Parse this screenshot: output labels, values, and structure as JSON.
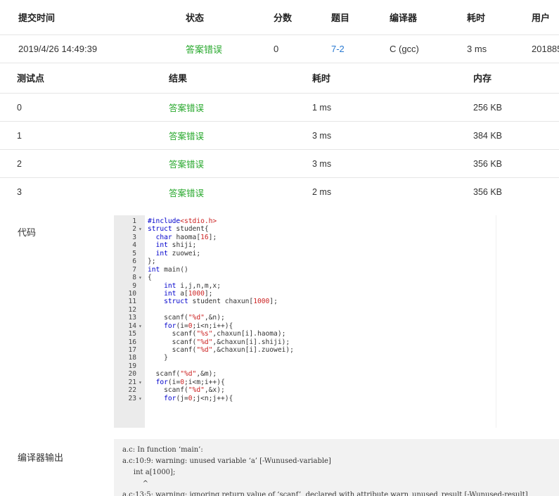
{
  "submission": {
    "headers": {
      "time": "提交时间",
      "status": "状态",
      "score": "分数",
      "problem": "题目",
      "compiler": "编译器",
      "duration": "耗时",
      "user": "用户"
    },
    "row": {
      "time": "2019/4/26 14:49:39",
      "status": "答案错误",
      "score": "0",
      "problem": "7-2",
      "compiler": "C (gcc)",
      "duration": "3 ms",
      "user": "201885"
    }
  },
  "test_points": {
    "headers": {
      "point": "测试点",
      "result": "结果",
      "duration": "耗时",
      "memory": "内存"
    },
    "rows": [
      {
        "point": "0",
        "result": "答案错误",
        "duration": "1 ms",
        "memory": "256 KB"
      },
      {
        "point": "1",
        "result": "答案错误",
        "duration": "3 ms",
        "memory": "384 KB"
      },
      {
        "point": "2",
        "result": "答案错误",
        "duration": "3 ms",
        "memory": "356 KB"
      },
      {
        "point": "3",
        "result": "答案错误",
        "duration": "2 ms",
        "memory": "356 KB"
      }
    ]
  },
  "code": {
    "label": "代码",
    "lines": [
      {
        "n": "1",
        "fold": "",
        "text": "#include<stdio.h>"
      },
      {
        "n": "2",
        "fold": "▾",
        "text": "struct student{"
      },
      {
        "n": "3",
        "fold": "",
        "text": "  char haoma[16];"
      },
      {
        "n": "4",
        "fold": "",
        "text": "  int shiji;"
      },
      {
        "n": "5",
        "fold": "",
        "text": "  int zuowei;"
      },
      {
        "n": "6",
        "fold": "",
        "text": "};"
      },
      {
        "n": "7",
        "fold": "",
        "text": "int main()"
      },
      {
        "n": "8",
        "fold": "▾",
        "text": "{"
      },
      {
        "n": "9",
        "fold": "",
        "text": "    int i,j,n,m,x;"
      },
      {
        "n": "10",
        "fold": "",
        "text": "    int a[1000];"
      },
      {
        "n": "11",
        "fold": "",
        "text": "    struct student chaxun[1000];"
      },
      {
        "n": "12",
        "fold": "",
        "text": ""
      },
      {
        "n": "13",
        "fold": "",
        "text": "    scanf(\"%d\",&n);"
      },
      {
        "n": "14",
        "fold": "▾",
        "text": "    for(i=0;i<n;i++){"
      },
      {
        "n": "15",
        "fold": "",
        "text": "      scanf(\"%s\",chaxun[i].haoma);"
      },
      {
        "n": "16",
        "fold": "",
        "text": "      scanf(\"%d\",&chaxun[i].shiji);"
      },
      {
        "n": "17",
        "fold": "",
        "text": "      scanf(\"%d\",&chaxun[i].zuowei);"
      },
      {
        "n": "18",
        "fold": "",
        "text": "    }"
      },
      {
        "n": "19",
        "fold": "",
        "text": ""
      },
      {
        "n": "20",
        "fold": "",
        "text": "  scanf(\"%d\",&m);"
      },
      {
        "n": "21",
        "fold": "▾",
        "text": "  for(i=0;i<m;i++){"
      },
      {
        "n": "22",
        "fold": "",
        "text": "    scanf(\"%d\",&x);"
      },
      {
        "n": "23",
        "fold": "▾",
        "text": "    for(j=0;j<n;j++){"
      }
    ]
  },
  "compiler_output": {
    "label": "编译器输出",
    "lines": [
      "a.c: In function ‘main’:",
      "a.c:10:9: warning: unused variable ‘a’ [-Wunused-variable]",
      "     int a[1000];",
      "         ^",
      "a.c:13:5: warning: ignoring return value of ‘scanf’, declared with attribute warn_unused_result [-Wunused-result]"
    ]
  },
  "colors": {
    "status_error": "#27a82c",
    "problem_link": "#2a7ad2",
    "gutter": "#ebebeb",
    "compiler_bg": "#f2f2f2"
  }
}
